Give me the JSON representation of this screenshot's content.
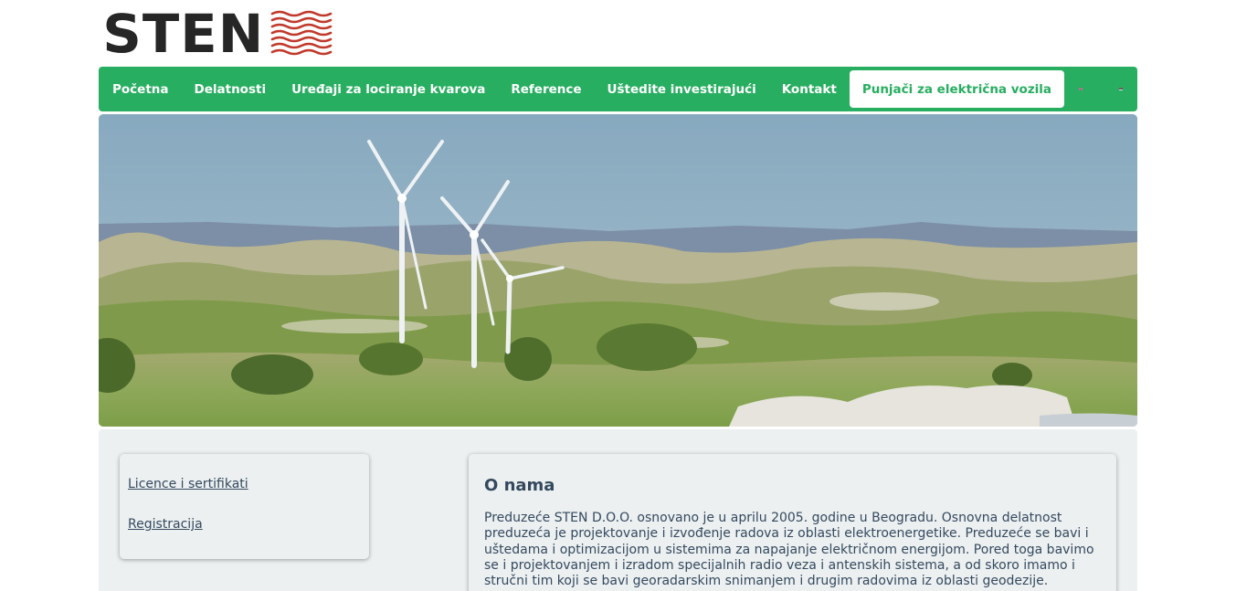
{
  "brand": {
    "name": "STEN",
    "accent_color": "#27ae60",
    "logo_wave_color": "#c0392b"
  },
  "nav": {
    "items": [
      {
        "label": "Početna"
      },
      {
        "label": "Delatnosti"
      },
      {
        "label": "Uređaji za lociranje kvarova"
      },
      {
        "label": "Reference"
      },
      {
        "label": "Uštedite investirajući"
      },
      {
        "label": "Kontakt"
      },
      {
        "label": "Punjači za električna vozila",
        "active": true
      }
    ],
    "languages": [
      {
        "icon": "flag-uk-icon"
      },
      {
        "icon": "flag-serbia-icon"
      }
    ]
  },
  "hero": {
    "icon": "wind-turbines-landscape-photo"
  },
  "sidebar": {
    "links": [
      {
        "label": "Licence i sertifikati"
      },
      {
        "label": "Registracija"
      }
    ]
  },
  "about": {
    "title": "O nama",
    "text": "Preduzeće STEN D.O.O. osnovano je u aprilu 2005. godine u Beogradu. Osnovna delatnost preduzeća je projektovanje i izvođenje radova iz oblasti elektroenergetike. Preduzeće se bavi i uštedama i optimizacijom u sistemima za napajanje električnom energijom. Pored toga bavimo se i projektovanjem i izradom specijalnih radio veza i antenskih sistema, a od skoro imamo i stručni tim koji se bavi georadarskim snimanjem i drugim radovima iz oblasti geodezije."
  }
}
